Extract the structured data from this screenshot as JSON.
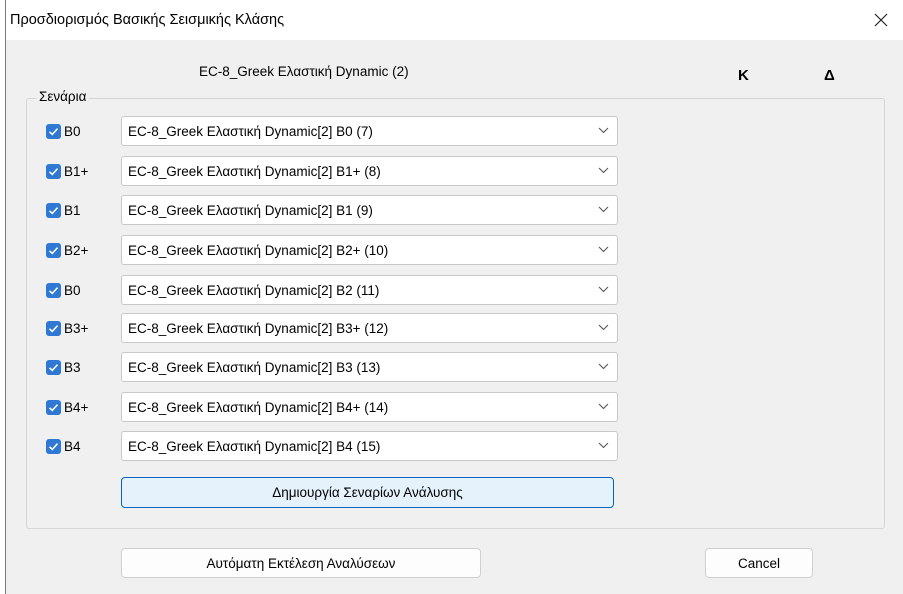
{
  "window": {
    "title": "Προσδιορισμός Βασικής Σεισμικής Κλάσης"
  },
  "header": {
    "analysis_label": "EC-8_Greek Ελαστική Dynamic (2)",
    "col_k": "Κ",
    "col_d": "Δ"
  },
  "scenarios": {
    "group_label": "Σενάρια",
    "rows": [
      {
        "label": "B0",
        "checked": true,
        "value": "EC-8_Greek Ελαστική Dynamic[2] B0 (7)"
      },
      {
        "label": "B1+",
        "checked": true,
        "value": "EC-8_Greek Ελαστική Dynamic[2] B1+ (8)"
      },
      {
        "label": "B1",
        "checked": true,
        "value": "EC-8_Greek Ελαστική Dynamic[2] B1 (9)"
      },
      {
        "label": "B2+",
        "checked": true,
        "value": "EC-8_Greek Ελαστική Dynamic[2] B2+ (10)"
      },
      {
        "label": "B0",
        "checked": true,
        "value": "EC-8_Greek Ελαστική Dynamic[2] B2 (11)"
      },
      {
        "label": "B3+",
        "checked": true,
        "value": "EC-8_Greek Ελαστική Dynamic[2] B3+ (12)"
      },
      {
        "label": "B3",
        "checked": true,
        "value": "EC-8_Greek Ελαστική Dynamic[2] B3 (13)"
      },
      {
        "label": "B4+",
        "checked": true,
        "value": "EC-8_Greek Ελαστική Dynamic[2] B4+ (14)"
      },
      {
        "label": "B4",
        "checked": true,
        "value": "EC-8_Greek Ελαστική Dynamic[2] B4 (15)"
      }
    ],
    "create_button": "Δημιουργία Σεναρίων Ανάλυσης"
  },
  "footer": {
    "auto_run_button": "Αυτόματη Εκτέλεση Αναλύσεων",
    "cancel_button": "Cancel"
  },
  "colors": {
    "accent": "#2f78d4",
    "primary_button_bg": "#e5f1fb",
    "primary_button_border": "#0067c0"
  }
}
